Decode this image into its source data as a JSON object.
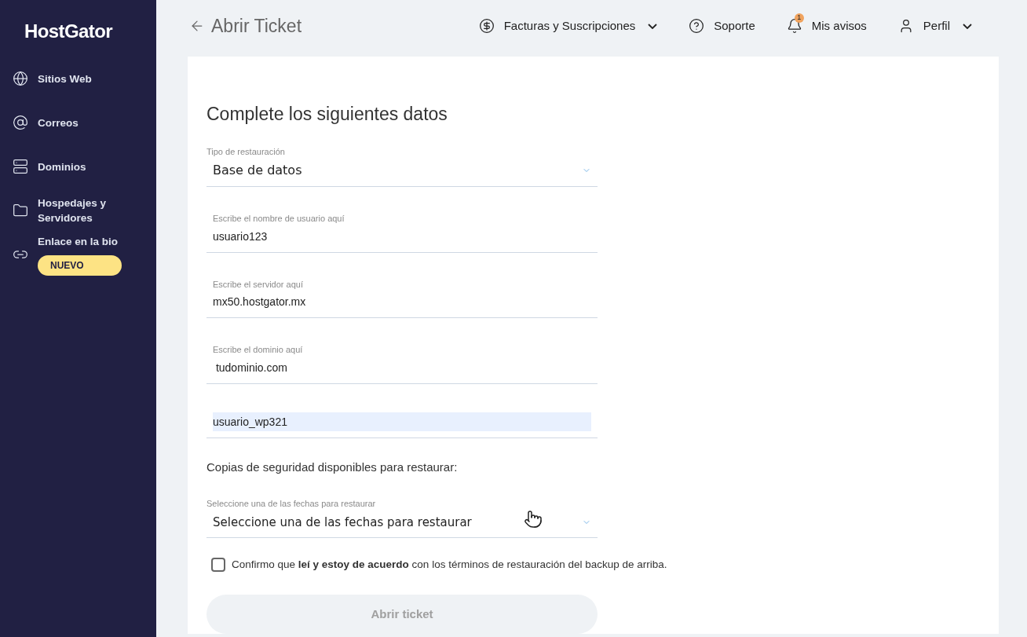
{
  "sidebar": {
    "logo": "HostGator",
    "items": [
      {
        "label": "Sitios Web"
      },
      {
        "label": "Correos"
      },
      {
        "label": "Dominios"
      },
      {
        "label": "Hospedajes y Servidores"
      },
      {
        "label": "Enlace en la bio",
        "badge": "NUEVO"
      }
    ]
  },
  "header": {
    "title": "Abrir Ticket",
    "nav": [
      {
        "label": "Facturas y Suscripciones",
        "dropdown": true
      },
      {
        "label": "Soporte",
        "dropdown": false
      },
      {
        "label": "Mis avisos",
        "dropdown": false,
        "badge": "1"
      },
      {
        "label": "Perfil",
        "dropdown": true
      }
    ]
  },
  "form": {
    "heading": "Complete los siguientes datos",
    "fields": [
      {
        "kind": "select",
        "label": "Tipo de restauración",
        "value": "Base de datos"
      },
      {
        "kind": "text",
        "label": "Escribe el nombre de usuario aquí",
        "value": "usuario123",
        "highlighted": false
      },
      {
        "kind": "text",
        "label": "Escribe el servidor aquí",
        "value": "mx50.hostgator.mx",
        "highlighted": false
      },
      {
        "kind": "text",
        "label": "Escribe el dominio aquí",
        "value": " tudominio.com",
        "highlighted": false
      },
      {
        "kind": "text",
        "value": "usuario_wp321",
        "highlighted": true
      }
    ],
    "backups_label": "Copias de seguridad disponibles para restaurar:",
    "date_select": {
      "label": "Seleccione una de las fechas para restaurar",
      "value": "Seleccione una de las fechas para restaurar"
    },
    "consent": {
      "text": "Confirmo que **leí y estoy de acuerdo** con los términos de restauración del backup de arriba.",
      "checked": false
    },
    "submit": {
      "label": "Abrir ticket",
      "disabled": true
    }
  }
}
